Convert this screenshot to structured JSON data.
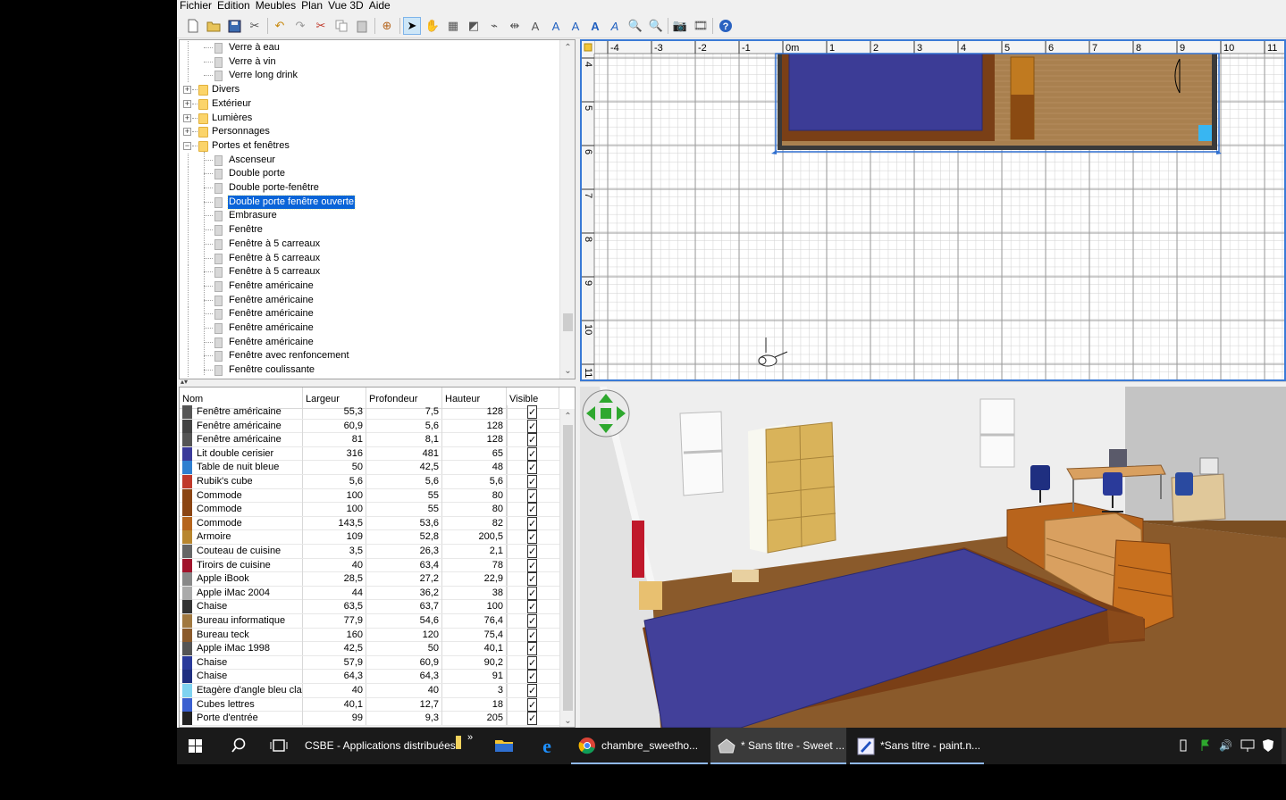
{
  "menu": [
    "Fichier",
    "Edition",
    "Meubles",
    "Plan",
    "Vue 3D",
    "Aide"
  ],
  "toolbar_icons": [
    "new-icon",
    "open-icon",
    "save-icon",
    "cut-tool-icon",
    "undo-icon",
    "redo-icon",
    "scissors-icon",
    "copy-icon",
    "paste-icon",
    "add-furniture-icon",
    "select-arrow-icon",
    "pan-hand-icon",
    "create-walls-icon",
    "create-rooms-icon",
    "create-polylines-icon",
    "create-dimensions-icon",
    "add-text-icon",
    "text-style-a-icon",
    "text-style-b-icon",
    "text-style-c-icon",
    "text-style-d-icon",
    "zoom-in-icon",
    "zoom-out-icon",
    "photo-icon",
    "video-icon",
    "help-icon"
  ],
  "catalog": {
    "items": [
      {
        "label": "Verre à eau",
        "level": 2
      },
      {
        "label": "Verre à vin",
        "level": 2
      },
      {
        "label": "Verre long drink",
        "level": 2
      },
      {
        "label": "Divers",
        "level": 1,
        "folder": true,
        "expanded": false
      },
      {
        "label": "Extérieur",
        "level": 1,
        "folder": true,
        "expanded": false
      },
      {
        "label": "Lumières",
        "level": 1,
        "folder": true,
        "expanded": false
      },
      {
        "label": "Personnages",
        "level": 1,
        "folder": true,
        "expanded": false
      },
      {
        "label": "Portes et fenêtres",
        "level": 1,
        "folder": true,
        "expanded": true
      },
      {
        "label": "Ascenseur",
        "level": 2
      },
      {
        "label": "Double porte",
        "level": 2
      },
      {
        "label": "Double porte-fenêtre",
        "level": 2
      },
      {
        "label": "Double porte fenêtre ouverte",
        "level": 2,
        "selected": true
      },
      {
        "label": "Embrasure",
        "level": 2
      },
      {
        "label": "Fenêtre",
        "level": 2
      },
      {
        "label": "Fenêtre à 5 carreaux",
        "level": 2
      },
      {
        "label": "Fenêtre à 5 carreaux",
        "level": 2
      },
      {
        "label": "Fenêtre à 5 carreaux",
        "level": 2
      },
      {
        "label": "Fenêtre américaine",
        "level": 2
      },
      {
        "label": "Fenêtre américaine",
        "level": 2
      },
      {
        "label": "Fenêtre américaine",
        "level": 2
      },
      {
        "label": "Fenêtre américaine",
        "level": 2
      },
      {
        "label": "Fenêtre américaine",
        "level": 2
      },
      {
        "label": "Fenêtre avec renfoncement",
        "level": 2
      },
      {
        "label": "Fenêtre coulissante",
        "level": 2
      }
    ]
  },
  "furniture": {
    "columns": [
      "Nom",
      "Largeur",
      "Profondeur",
      "Hauteur",
      "Visible"
    ],
    "rows": [
      {
        "name": "Fenêtre américaine",
        "w": "55,3",
        "d": "7,5",
        "h": "128",
        "icon": "#555"
      },
      {
        "name": "Fenêtre américaine",
        "w": "60,9",
        "d": "5,6",
        "h": "128",
        "icon": "#444"
      },
      {
        "name": "Fenêtre américaine",
        "w": "81",
        "d": "8,1",
        "h": "128",
        "icon": "#555"
      },
      {
        "name": "Lit double cerisier",
        "w": "316",
        "d": "481",
        "h": "65",
        "icon": "#3a3a9a"
      },
      {
        "name": "Table de nuit bleue",
        "w": "50",
        "d": "42,5",
        "h": "48",
        "icon": "#2f7fd0"
      },
      {
        "name": "Rubik's cube",
        "w": "5,6",
        "d": "5,6",
        "h": "5,6",
        "icon": "#c0392b"
      },
      {
        "name": "Commode",
        "w": "100",
        "d": "55",
        "h": "80",
        "icon": "#8b4513"
      },
      {
        "name": "Commode",
        "w": "100",
        "d": "55",
        "h": "80",
        "icon": "#8b4513"
      },
      {
        "name": "Commode",
        "w": "143,5",
        "d": "53,6",
        "h": "82",
        "icon": "#b5651d"
      },
      {
        "name": "Armoire",
        "w": "109",
        "d": "52,8",
        "h": "200,5",
        "icon": "#b8862f"
      },
      {
        "name": "Couteau de cuisine",
        "w": "3,5",
        "d": "26,3",
        "h": "2,1",
        "icon": "#666"
      },
      {
        "name": "Tiroirs de cuisine",
        "w": "40",
        "d": "63,4",
        "h": "78",
        "icon": "#a0132b"
      },
      {
        "name": "Apple iBook",
        "w": "28,5",
        "d": "27,2",
        "h": "22,9",
        "icon": "#888"
      },
      {
        "name": "Apple iMac 2004",
        "w": "44",
        "d": "36,2",
        "h": "38",
        "icon": "#aaa"
      },
      {
        "name": "Chaise",
        "w": "63,5",
        "d": "63,7",
        "h": "100",
        "icon": "#333"
      },
      {
        "name": "Bureau informatique",
        "w": "77,9",
        "d": "54,6",
        "h": "76,4",
        "icon": "#a07840"
      },
      {
        "name": "Bureau teck",
        "w": "160",
        "d": "120",
        "h": "75,4",
        "icon": "#8a5a2b"
      },
      {
        "name": "Apple iMac 1998",
        "w": "42,5",
        "d": "50",
        "h": "40,1",
        "icon": "#555"
      },
      {
        "name": "Chaise",
        "w": "57,9",
        "d": "60,9",
        "h": "90,2",
        "icon": "#2a3a9a"
      },
      {
        "name": "Chaise",
        "w": "64,3",
        "d": "64,3",
        "h": "91",
        "icon": "#1f2f80"
      },
      {
        "name": "Etagère d'angle bleu clair",
        "w": "40",
        "d": "40",
        "h": "3",
        "icon": "#7fd3f0"
      },
      {
        "name": "Cubes lettres",
        "w": "40,1",
        "d": "12,7",
        "h": "18",
        "icon": "#3a5fd0"
      },
      {
        "name": "Porte d'entrée",
        "w": "99",
        "d": "9,3",
        "h": "205",
        "icon": "#222"
      }
    ]
  },
  "plan": {
    "ruler_top": [
      "-4",
      "-3",
      "-2",
      "-1",
      "0m",
      "1",
      "2",
      "3",
      "4",
      "5",
      "6",
      "7",
      "8",
      "9",
      "10",
      "11"
    ],
    "ruler_left": [
      "4",
      "5",
      "6",
      "7",
      "8",
      "9",
      "10",
      "11"
    ]
  },
  "taskbar": {
    "items": [
      {
        "label": "CSBE - Applications distribuées"
      },
      {
        "label": "chambre_sweetho..."
      },
      {
        "label": "* Sans titre - Sweet ..."
      },
      {
        "label": "*Sans titre - paint.n..."
      }
    ],
    "overflow_label": "»"
  },
  "colors": {
    "selection": "#0a64d8",
    "plan_border": "#3a7ad6",
    "bed_blue": "#3c3c96",
    "floor_wood": "#9a6e3e"
  }
}
